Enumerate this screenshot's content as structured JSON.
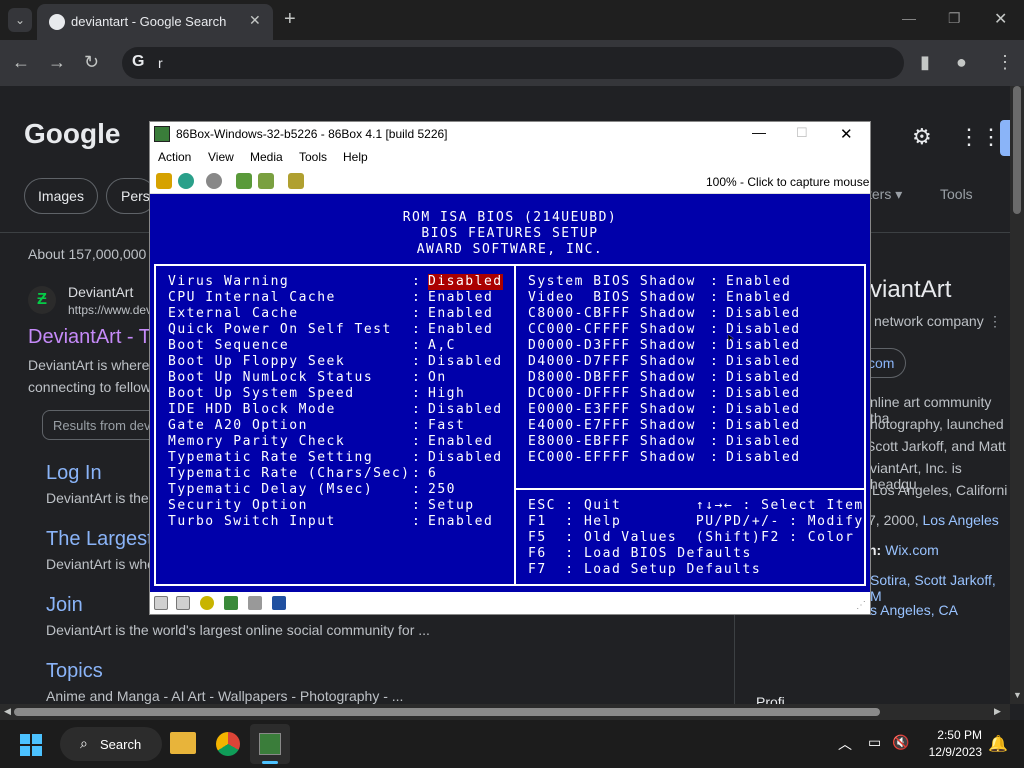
{
  "browser": {
    "tab_title": "deviantart - Google Search",
    "omnibox_value": "r",
    "new_tab": "+",
    "tab_close": "✕"
  },
  "google": {
    "logo": "Google",
    "chips": [
      "Images",
      "Persp"
    ],
    "tools": "Tools",
    "ters": "ters ▾",
    "about": "About 157,000,000",
    "site_name": "DeviantArt",
    "site_url": "https://www.dev",
    "result_title": "DeviantArt - T",
    "result_snip1": "DeviantArt is where",
    "result_snip2": "connecting to fellow",
    "results_from": "Results from dev",
    "links": [
      {
        "title": "Log In",
        "snip": "DeviantArt is the"
      },
      {
        "title": "The Largest",
        "snip": "DeviantArt is whe"
      },
      {
        "title": "Join",
        "snip": "DeviantArt is the world's largest online social community for ..."
      },
      {
        "title": "Topics",
        "snip": "Anime and Manga - AI Art - Wallpapers - Photography - ..."
      }
    ],
    "kp_title": "viantArt",
    "kp_sub": "network company",
    "kp_btn": "com",
    "kp_lines": [
      "nline art community tha",
      "hotography, launched",
      "Scott Jarkoff, and Matt",
      "viantArt, Inc. is headqu",
      "Los Angeles, Californi"
    ],
    "kp_founded": "7, 2000, ",
    "kp_founded_link": "Los Angeles",
    "kp_parent_label": "n: ",
    "kp_parent": "Wix.com",
    "kp_founders": "Sotira, Scott Jarkoff, M",
    "kp_hq": "s Angeles, CA",
    "kp_partial": "Profi"
  },
  "emulator": {
    "title": "86Box-Windows-32-b5226 - 86Box 4.1 [build 5226]",
    "menu": [
      "Action",
      "View",
      "Media",
      "Tools",
      "Help"
    ],
    "capture_hint": "100% - Click to capture mouse",
    "bios_header": [
      "ROM ISA BIOS (214UEUBD)",
      "BIOS FEATURES SETUP",
      "AWARD SOFTWARE, INC."
    ],
    "left_rows": [
      {
        "label": "Virus Warning",
        "value": "Disabled"
      },
      {
        "label": "CPU Internal Cache",
        "value": "Enabled"
      },
      {
        "label": "External Cache",
        "value": "Enabled"
      },
      {
        "label": "Quick Power On Self Test",
        "value": "Enabled"
      },
      {
        "label": "Boot Sequence",
        "value": "A,C"
      },
      {
        "label": "Boot Up Floppy Seek",
        "value": "Disabled"
      },
      {
        "label": "Boot Up NumLock Status",
        "value": "On"
      },
      {
        "label": "Boot Up System Speed",
        "value": "High"
      },
      {
        "label": "IDE HDD Block Mode",
        "value": "Disabled"
      },
      {
        "label": "Gate A20 Option",
        "value": "Fast"
      },
      {
        "label": "Memory Parity Check",
        "value": "Enabled"
      },
      {
        "label": "Typematic Rate Setting",
        "value": "Disabled"
      },
      {
        "label": "Typematic Rate (Chars/Sec)",
        "value": "6"
      },
      {
        "label": "Typematic Delay (Msec)",
        "value": "250"
      },
      {
        "label": "Security Option",
        "value": "Setup"
      },
      {
        "label": "Turbo Switch Input",
        "value": "Enabled"
      }
    ],
    "right_rows": [
      {
        "label": "System BIOS Shadow",
        "value": "Enabled"
      },
      {
        "label": "Video  BIOS Shadow",
        "value": "Enabled"
      },
      {
        "label": "C8000-CBFFF Shadow",
        "value": "Disabled"
      },
      {
        "label": "CC000-CFFFF Shadow",
        "value": "Disabled"
      },
      {
        "label": "D0000-D3FFF Shadow",
        "value": "Disabled"
      },
      {
        "label": "D4000-D7FFF Shadow",
        "value": "Disabled"
      },
      {
        "label": "D8000-DBFFF Shadow",
        "value": "Disabled"
      },
      {
        "label": "DC000-DFFFF Shadow",
        "value": "Disabled"
      },
      {
        "label": "E0000-E3FFF Shadow",
        "value": "Disabled"
      },
      {
        "label": "E4000-E7FFF Shadow",
        "value": "Disabled"
      },
      {
        "label": "E8000-EBFFF Shadow",
        "value": "Disabled"
      },
      {
        "label": "EC000-EFFFF Shadow",
        "value": "Disabled"
      }
    ],
    "help_lines": [
      "ESC : Quit        ↑↓→← : Select Item",
      "F1  : Help        PU/PD/+/- : Modify",
      "F5  : Old Values  (Shift)F2 : Color",
      "F6  : Load BIOS Defaults",
      "F7  : Load Setup Defaults"
    ]
  },
  "taskbar": {
    "search": "Search",
    "time": "2:50 PM",
    "date": "12/9/2023"
  },
  "colors": {
    "bios_bg": "#0000aa",
    "highlight": "#aa0000",
    "chrome_bg": "#202124"
  }
}
